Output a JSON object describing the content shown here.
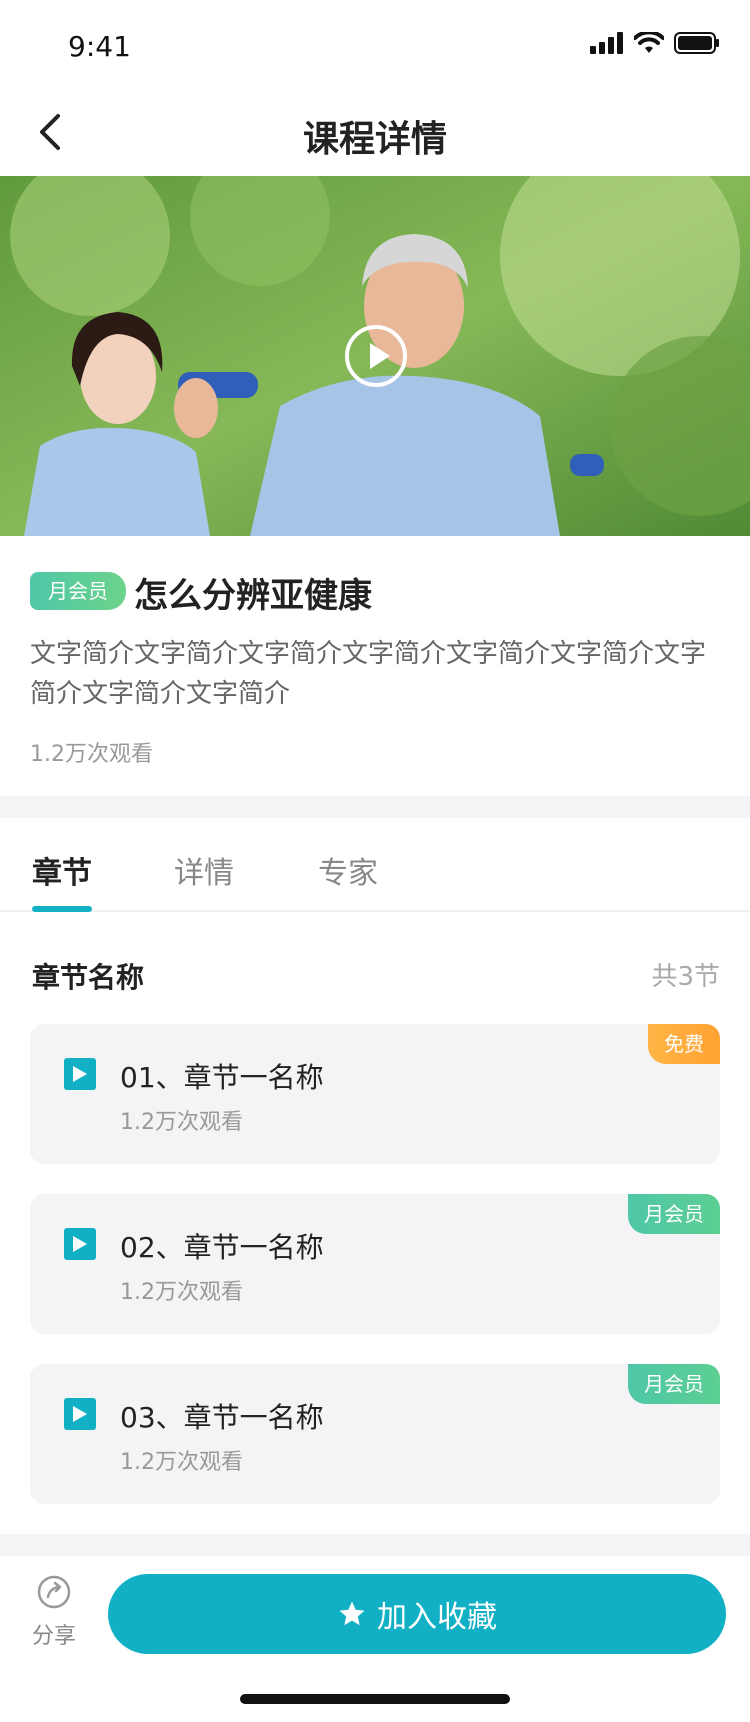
{
  "status_bar": {
    "time": "9:41"
  },
  "nav": {
    "title": "课程详情"
  },
  "course": {
    "badge": "月会员",
    "title": "怎么分辨亚健康",
    "description": "文字简介文字简介文字简介文字简介文字简介文字简介文字简介文字简介文字简介",
    "views": "1.2万次观看"
  },
  "tabs": [
    {
      "label": "章节",
      "active": true
    },
    {
      "label": "详情",
      "active": false
    },
    {
      "label": "专家",
      "active": false
    }
  ],
  "chapters_section": {
    "title": "章节名称",
    "count": "共3节",
    "items": [
      {
        "name": "01、章节一名称",
        "views": "1.2万次观看",
        "badge": "免费"
      },
      {
        "name": "02、章节一名称",
        "views": "1.2万次观看",
        "badge": "月会员"
      },
      {
        "name": "03、章节一名称",
        "views": "1.2万次观看",
        "badge": "月会员"
      }
    ]
  },
  "bottom": {
    "share_label": "分享",
    "collect_label": "加入收藏"
  },
  "colors": {
    "accent": "#12b0c4",
    "free": "#ffa332",
    "member": "#5ccf92"
  }
}
